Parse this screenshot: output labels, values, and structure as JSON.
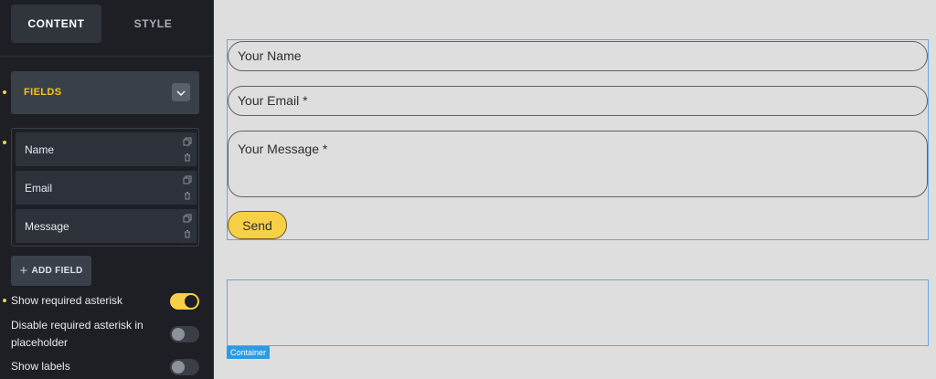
{
  "sidebar": {
    "tabs": [
      {
        "label": "CONTENT",
        "active": true
      },
      {
        "label": "STYLE",
        "active": false
      }
    ],
    "fields_section": {
      "title": "FIELDS",
      "items": [
        {
          "label": "Name"
        },
        {
          "label": "Email"
        },
        {
          "label": "Message"
        }
      ],
      "add_label": "ADD FIELD"
    },
    "options": [
      {
        "label": "Show required asterisk",
        "enabled": true
      },
      {
        "label": "Disable required asterisk in placeholder",
        "enabled": false
      },
      {
        "label": "Show labels",
        "enabled": false
      }
    ]
  },
  "canvas": {
    "form": {
      "name_placeholder": "Your Name",
      "email_placeholder": "Your Email *",
      "message_placeholder": "Your Message *",
      "submit_label": "Send"
    },
    "container_label": "Container"
  },
  "colors": {
    "accent": "#f7d046",
    "sidebar_bg": "#1d1f24",
    "canvas_bg": "#dedede",
    "selection_blue": "#62a8e6",
    "tag_blue": "#2b9be3"
  }
}
